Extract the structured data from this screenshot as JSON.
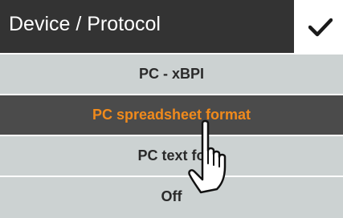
{
  "title_bar": {
    "title": "Device / Protocol"
  },
  "confirm": {
    "icon": "checkmark-icon"
  },
  "menu": {
    "items": [
      {
        "label": "PC - xBPI",
        "selected": false
      },
      {
        "label": "PC spreadsheet format",
        "selected": true
      },
      {
        "label": "PC text fo",
        "selected": false
      },
      {
        "label": "Off",
        "selected": false
      }
    ]
  },
  "overlay": {
    "icon": "pointing-hand-icon"
  },
  "colors": {
    "title_bg": "#333333",
    "selected_bg": "#4b4b4b",
    "selected_text": "#f08a1c",
    "item_bg": "#ccd2d2"
  }
}
